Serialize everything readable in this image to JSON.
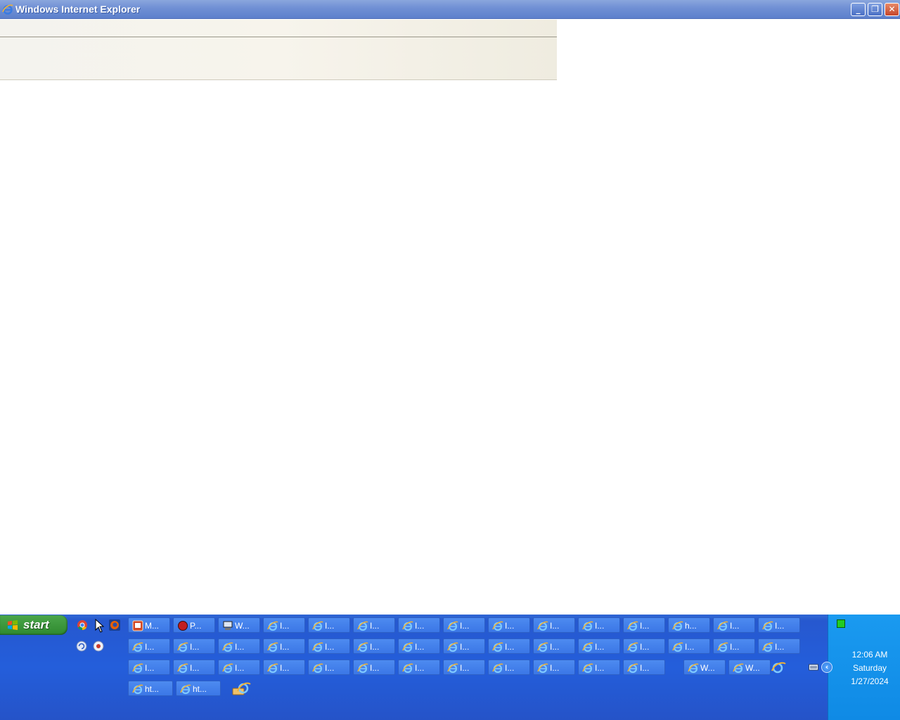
{
  "window": {
    "title": "Windows Internet Explorer",
    "buttons": {
      "minimize": "_",
      "maximize": "❐",
      "close": "✕"
    }
  },
  "taskbar": {
    "start_label": "start",
    "quick_launch": [
      "chrome-icon",
      "cursor-icon",
      "firefox-icon",
      "refresh-icon",
      "media-icon"
    ],
    "rows": [
      [
        {
          "icon": "powerpoint-icon",
          "label": "M..."
        },
        {
          "icon": "record-icon",
          "label": "P..."
        },
        {
          "icon": "computer-icon",
          "label": "W..."
        },
        {
          "icon": "ie-icon",
          "label": "I..."
        },
        {
          "icon": "ie-icon",
          "label": "I..."
        },
        {
          "icon": "ie-icon",
          "label": "I..."
        },
        {
          "icon": "ie-icon",
          "label": "I..."
        },
        {
          "icon": "ie-icon",
          "label": "I..."
        },
        {
          "icon": "ie-icon",
          "label": "I..."
        },
        {
          "icon": "ie-icon",
          "label": "I..."
        },
        {
          "icon": "ie-icon",
          "label": "I..."
        },
        {
          "icon": "ie-icon",
          "label": "I..."
        },
        {
          "icon": "ie-icon",
          "label": "h..."
        },
        {
          "icon": "ie-icon",
          "label": "I..."
        },
        {
          "icon": "ie-icon",
          "label": "I..."
        }
      ],
      [
        {
          "icon": "ie-icon",
          "label": "I..."
        },
        {
          "icon": "ie-icon",
          "label": "I..."
        },
        {
          "icon": "ie-icon",
          "label": "I..."
        },
        {
          "icon": "ie-icon",
          "label": "I..."
        },
        {
          "icon": "ie-icon",
          "label": "I..."
        },
        {
          "icon": "ie-icon",
          "label": "I..."
        },
        {
          "icon": "ie-icon",
          "label": "I..."
        },
        {
          "icon": "ie-icon",
          "label": "I..."
        },
        {
          "icon": "ie-icon",
          "label": "I..."
        },
        {
          "icon": "ie-icon",
          "label": "I..."
        },
        {
          "icon": "ie-icon",
          "label": "I..."
        },
        {
          "icon": "ie-icon",
          "label": "I..."
        },
        {
          "icon": "ie-icon",
          "label": "I..."
        },
        {
          "icon": "ie-icon",
          "label": "I..."
        },
        {
          "icon": "ie-icon",
          "label": "I..."
        }
      ],
      [
        {
          "icon": "ie-icon",
          "label": "I..."
        },
        {
          "icon": "ie-icon",
          "label": "I..."
        },
        {
          "icon": "ie-icon",
          "label": "I..."
        },
        {
          "icon": "ie-icon",
          "label": "I..."
        },
        {
          "icon": "ie-icon",
          "label": "I..."
        },
        {
          "icon": "ie-icon",
          "label": "I..."
        },
        {
          "icon": "ie-icon",
          "label": "I..."
        },
        {
          "icon": "ie-icon",
          "label": "I..."
        },
        {
          "icon": "ie-icon",
          "label": "I..."
        },
        {
          "icon": "ie-icon",
          "label": "I..."
        },
        {
          "icon": "ie-icon",
          "label": "I..."
        },
        {
          "icon": "ie-icon",
          "label": "I..."
        },
        {
          "icon": "ie-icon",
          "label": "W..."
        },
        {
          "icon": "ie-icon",
          "label": "W..."
        }
      ],
      [
        {
          "icon": "ie-icon",
          "label": "ht..."
        },
        {
          "icon": "ie-icon",
          "label": "ht..."
        }
      ]
    ]
  },
  "tray": {
    "time": "12:06 AM",
    "day": "Saturday",
    "date": "1/27/2024",
    "expand_label": "‹"
  },
  "colors": {
    "taskbar": "#245edb",
    "task_button": "#3b77e6",
    "tray": "#0f8ae5",
    "start": "#2f8a2f"
  }
}
